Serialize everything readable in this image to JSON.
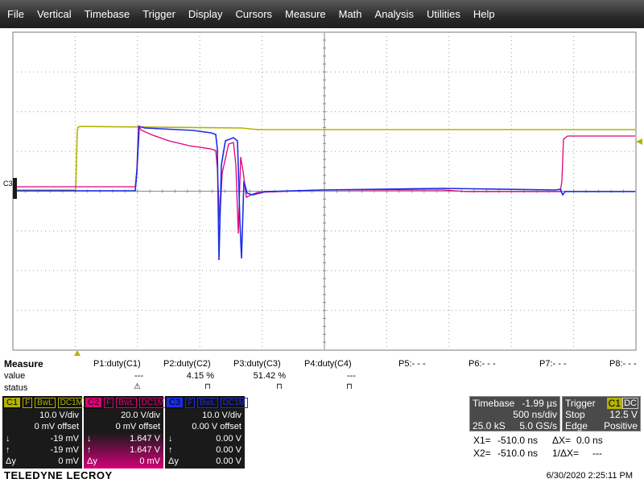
{
  "menu": [
    "File",
    "Vertical",
    "Timebase",
    "Trigger",
    "Display",
    "Cursors",
    "Measure",
    "Math",
    "Analysis",
    "Utilities",
    "Help"
  ],
  "colors": {
    "c1": "#b3b300",
    "c2": "#e0007a",
    "c3": "#1a2ee6",
    "grid": "#7a7a7a"
  },
  "grid_labels": {
    "c3_marker": "C3"
  },
  "measure": {
    "title": "Measure",
    "row_labels": [
      "value",
      "status"
    ],
    "params": [
      {
        "name": "P1:duty(C1)",
        "value": "---",
        "status": "warning-icon"
      },
      {
        "name": "P2:duty(C2)",
        "value": "4.15 %",
        "status": "pulse-icon"
      },
      {
        "name": "P3:duty(C3)",
        "value": "51.42 %",
        "status": "pulse-icon"
      },
      {
        "name": "P4:duty(C4)",
        "value": "---",
        "status": "pulse-icon"
      },
      {
        "name": "P5:- - -",
        "value": "",
        "status": ""
      },
      {
        "name": "P6:- - -",
        "value": "",
        "status": ""
      },
      {
        "name": "P7:- - -",
        "value": "",
        "status": ""
      },
      {
        "name": "P8:- - -",
        "value": "",
        "status": ""
      }
    ]
  },
  "channels": [
    {
      "name": "C1",
      "flags": [
        "F",
        "BwL",
        "DC1M"
      ],
      "vdiv": "10.0 V/div",
      "offset": "0 mV offset",
      "down": "-19 mV",
      "up": "-19 mV",
      "dy": "0 mV"
    },
    {
      "name": "C2",
      "flags": [
        "F",
        "BwL",
        "DC1M"
      ],
      "vdiv": "20.0 V/div",
      "offset": "0 mV offset",
      "down": "1.647 V",
      "up": "1.647 V",
      "dy": "0 mV"
    },
    {
      "name": "C3",
      "flags": [
        "F",
        "BwL",
        "DC1M"
      ],
      "vdiv": "10.0 V/div",
      "offset": "0.00 V offset",
      "down": "0.00 V",
      "up": "0.00 V",
      "dy": "0.00 V"
    }
  ],
  "channel_row_labels": {
    "down": "↓",
    "up": "↑",
    "dy": "Δy"
  },
  "timebase": {
    "label": "Timebase",
    "delay": "-1.99 µs",
    "tdiv": "500 ns/div",
    "samples": "25.0 kS",
    "rate": "5.0 GS/s"
  },
  "trigger": {
    "label": "Trigger",
    "source": "C1",
    "coupling": "DC",
    "mode": "Stop",
    "level": "12.5 V",
    "type": "Edge",
    "slope": "Positive"
  },
  "cursors": {
    "x1_label": "X1=",
    "x1": "-510.0 ns",
    "dx_label": "ΔX=",
    "dx": "0.0 ns",
    "x2_label": "X2=",
    "x2": "-510.0 ns",
    "inv_label": "1/ΔX=",
    "inv": "---"
  },
  "brand": "TELEDYNE LECROY",
  "datetime": "6/30/2020 2:25:11 PM"
}
